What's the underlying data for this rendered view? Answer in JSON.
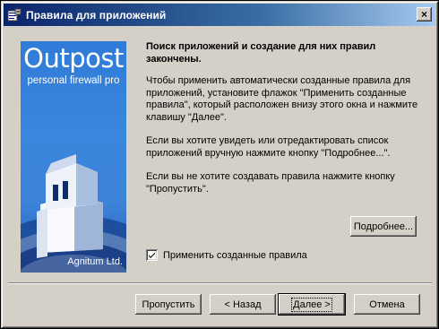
{
  "window": {
    "title": "Правила для приложений",
    "close_glyph": "×"
  },
  "banner": {
    "product": "Outpost",
    "subtitle": "personal firewall pro",
    "company": "Agnitum Ltd."
  },
  "content": {
    "heading": "Поиск приложений и создание для них правил закончены.",
    "paragraph1": "Чтобы применить автоматически созданные правила для приложений, установите флажок \"Применить созданные правила\", который расположен внизу этого окна и нажмите клавишу \"Далее\".",
    "paragraph2": "Если вы хотите увидеть или отредактировать список приложений вручную нажмите кнопку \"Подробнее...\".",
    "paragraph3": "Если вы не хотите создавать правила нажмите кнопку \"Пропустить\"."
  },
  "details_button": "Подробнее...",
  "checkbox": {
    "label": "Применить созданные правила",
    "checked": true
  },
  "buttons": {
    "skip": "Пропустить",
    "back": "< Назад",
    "next": "Далее >",
    "cancel": "Отмена"
  }
}
